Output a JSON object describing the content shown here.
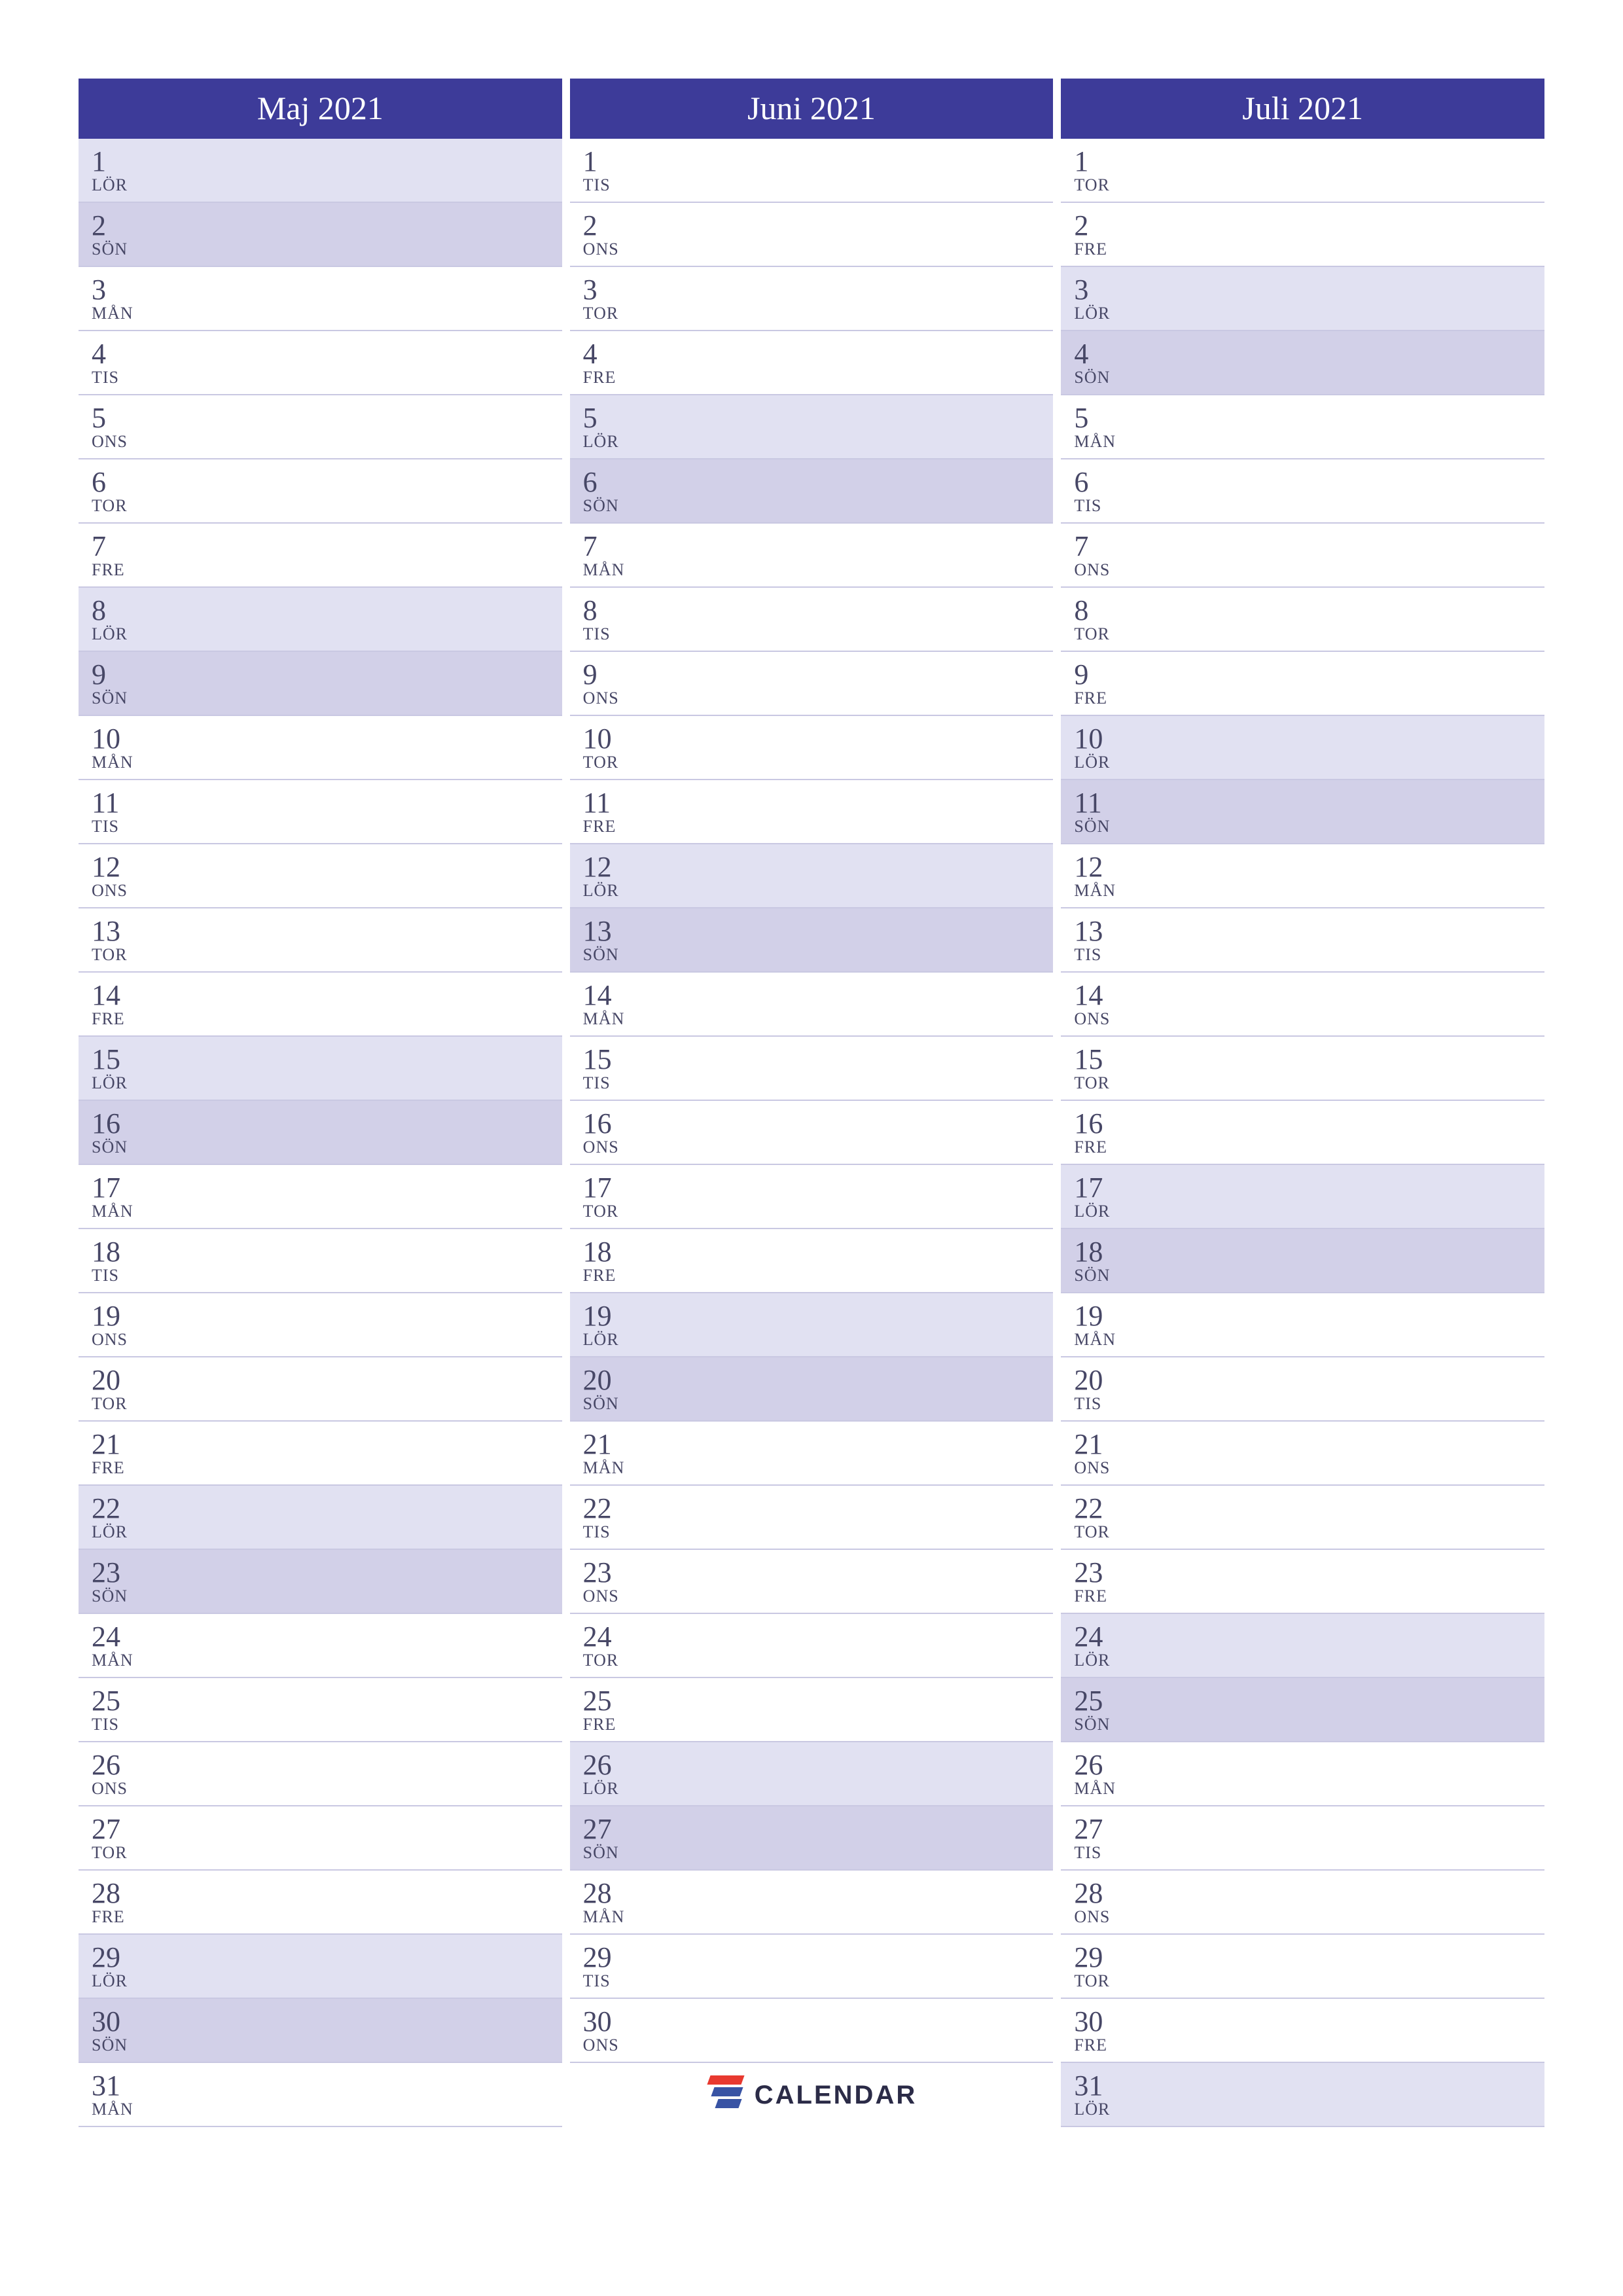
{
  "logo_text": "CALENDAR",
  "day_abbr": {
    "mon": "MÅN",
    "tue": "TIS",
    "wed": "ONS",
    "thu": "TOR",
    "fri": "FRE",
    "sat": "LÖR",
    "sun": "SÖN"
  },
  "months": [
    {
      "title": "Maj 2021",
      "days": [
        {
          "n": "1",
          "d": "sat"
        },
        {
          "n": "2",
          "d": "sun"
        },
        {
          "n": "3",
          "d": "mon"
        },
        {
          "n": "4",
          "d": "tue"
        },
        {
          "n": "5",
          "d": "wed"
        },
        {
          "n": "6",
          "d": "thu"
        },
        {
          "n": "7",
          "d": "fri"
        },
        {
          "n": "8",
          "d": "sat"
        },
        {
          "n": "9",
          "d": "sun"
        },
        {
          "n": "10",
          "d": "mon"
        },
        {
          "n": "11",
          "d": "tue"
        },
        {
          "n": "12",
          "d": "wed"
        },
        {
          "n": "13",
          "d": "thu"
        },
        {
          "n": "14",
          "d": "fri"
        },
        {
          "n": "15",
          "d": "sat"
        },
        {
          "n": "16",
          "d": "sun"
        },
        {
          "n": "17",
          "d": "mon"
        },
        {
          "n": "18",
          "d": "tue"
        },
        {
          "n": "19",
          "d": "wed"
        },
        {
          "n": "20",
          "d": "thu"
        },
        {
          "n": "21",
          "d": "fri"
        },
        {
          "n": "22",
          "d": "sat"
        },
        {
          "n": "23",
          "d": "sun"
        },
        {
          "n": "24",
          "d": "mon"
        },
        {
          "n": "25",
          "d": "tue"
        },
        {
          "n": "26",
          "d": "wed"
        },
        {
          "n": "27",
          "d": "thu"
        },
        {
          "n": "28",
          "d": "fri"
        },
        {
          "n": "29",
          "d": "sat"
        },
        {
          "n": "30",
          "d": "sun"
        },
        {
          "n": "31",
          "d": "mon"
        }
      ]
    },
    {
      "title": "Juni 2021",
      "days": [
        {
          "n": "1",
          "d": "tue"
        },
        {
          "n": "2",
          "d": "wed"
        },
        {
          "n": "3",
          "d": "thu"
        },
        {
          "n": "4",
          "d": "fri"
        },
        {
          "n": "5",
          "d": "sat"
        },
        {
          "n": "6",
          "d": "sun"
        },
        {
          "n": "7",
          "d": "mon"
        },
        {
          "n": "8",
          "d": "tue"
        },
        {
          "n": "9",
          "d": "wed"
        },
        {
          "n": "10",
          "d": "thu"
        },
        {
          "n": "11",
          "d": "fri"
        },
        {
          "n": "12",
          "d": "sat"
        },
        {
          "n": "13",
          "d": "sun"
        },
        {
          "n": "14",
          "d": "mon"
        },
        {
          "n": "15",
          "d": "tue"
        },
        {
          "n": "16",
          "d": "wed"
        },
        {
          "n": "17",
          "d": "thu"
        },
        {
          "n": "18",
          "d": "fri"
        },
        {
          "n": "19",
          "d": "sat"
        },
        {
          "n": "20",
          "d": "sun"
        },
        {
          "n": "21",
          "d": "mon"
        },
        {
          "n": "22",
          "d": "tue"
        },
        {
          "n": "23",
          "d": "wed"
        },
        {
          "n": "24",
          "d": "thu"
        },
        {
          "n": "25",
          "d": "fri"
        },
        {
          "n": "26",
          "d": "sat"
        },
        {
          "n": "27",
          "d": "sun"
        },
        {
          "n": "28",
          "d": "mon"
        },
        {
          "n": "29",
          "d": "tue"
        },
        {
          "n": "30",
          "d": "wed"
        }
      ],
      "show_logo_after": true
    },
    {
      "title": "Juli 2021",
      "days": [
        {
          "n": "1",
          "d": "thu"
        },
        {
          "n": "2",
          "d": "fri"
        },
        {
          "n": "3",
          "d": "sat"
        },
        {
          "n": "4",
          "d": "sun"
        },
        {
          "n": "5",
          "d": "mon"
        },
        {
          "n": "6",
          "d": "tue"
        },
        {
          "n": "7",
          "d": "wed"
        },
        {
          "n": "8",
          "d": "thu"
        },
        {
          "n": "9",
          "d": "fri"
        },
        {
          "n": "10",
          "d": "sat"
        },
        {
          "n": "11",
          "d": "sun"
        },
        {
          "n": "12",
          "d": "mon"
        },
        {
          "n": "13",
          "d": "tue"
        },
        {
          "n": "14",
          "d": "wed"
        },
        {
          "n": "15",
          "d": "thu"
        },
        {
          "n": "16",
          "d": "fri"
        },
        {
          "n": "17",
          "d": "sat"
        },
        {
          "n": "18",
          "d": "sun"
        },
        {
          "n": "19",
          "d": "mon"
        },
        {
          "n": "20",
          "d": "tue"
        },
        {
          "n": "21",
          "d": "wed"
        },
        {
          "n": "22",
          "d": "thu"
        },
        {
          "n": "23",
          "d": "fri"
        },
        {
          "n": "24",
          "d": "sat"
        },
        {
          "n": "25",
          "d": "sun"
        },
        {
          "n": "26",
          "d": "mon"
        },
        {
          "n": "27",
          "d": "tue"
        },
        {
          "n": "28",
          "d": "wed"
        },
        {
          "n": "29",
          "d": "thu"
        },
        {
          "n": "30",
          "d": "fri"
        },
        {
          "n": "31",
          "d": "sat"
        }
      ]
    }
  ]
}
